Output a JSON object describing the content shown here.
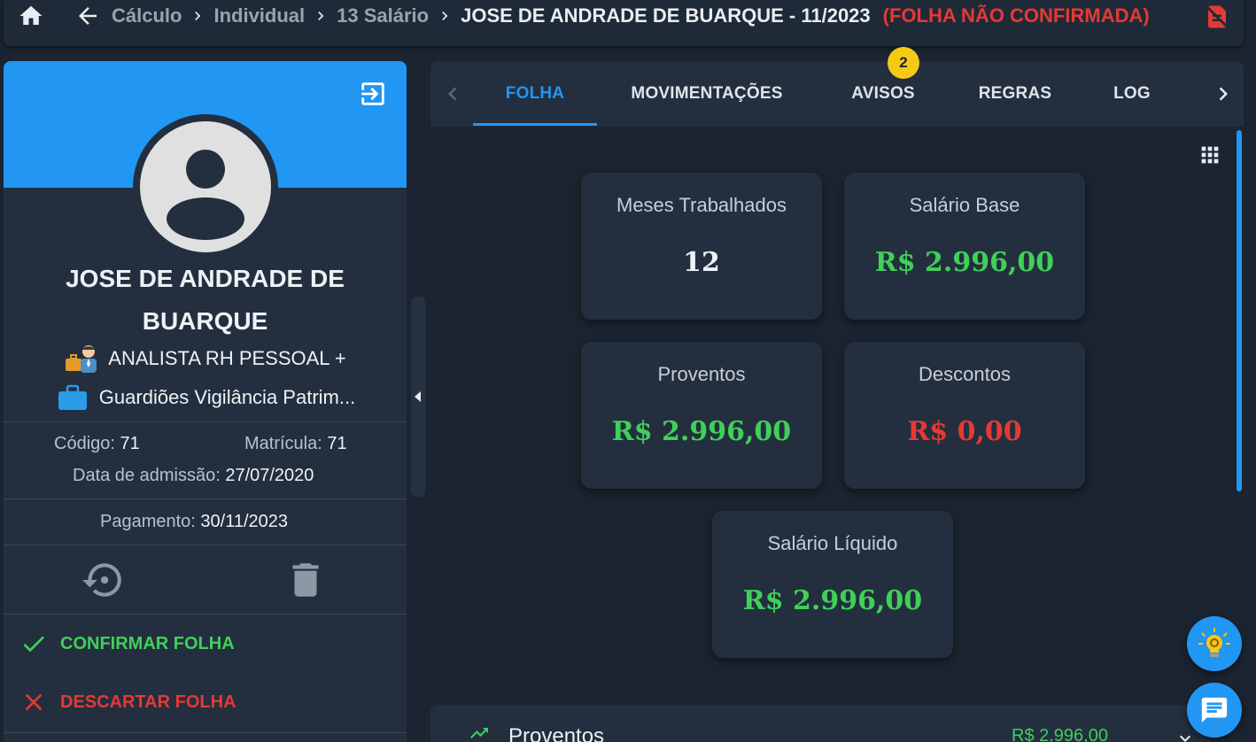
{
  "topbar": {
    "breadcrumbs": [
      "Cálculo",
      "Individual",
      "13 Salário"
    ],
    "current": "JOSE DE ANDRADE DE BUARQUE - 11/2023",
    "status": "(FOLHA NÃO CONFIRMADA)"
  },
  "profile": {
    "name_line1": "JOSE DE ANDRADE DE",
    "name_line2": "BUARQUE",
    "role": "ANALISTA RH PESSOAL +",
    "company": "Guardiões Vigilância Patrim...",
    "codigo_label": "Código:",
    "codigo": "71",
    "matricula_label": "Matrícula:",
    "matricula": "71",
    "admissao_label": "Data de admissão:",
    "admissao": "27/07/2020",
    "pagamento_label": "Pagamento:",
    "pagamento": "30/11/2023",
    "confirm_label": "CONFIRMAR FOLHA",
    "discard_label": "DESCARTAR FOLHA"
  },
  "tabs": {
    "items": [
      "FOLHA",
      "MOVIMENTAÇÕES",
      "AVISOS",
      "REGRAS",
      "LOG"
    ],
    "active": "FOLHA",
    "avisos_badge": "2"
  },
  "cards": {
    "meses": {
      "label": "Meses Trabalhados",
      "value": "12"
    },
    "salario_base": {
      "label": "Salário Base",
      "value": "R$ 2.996,00"
    },
    "proventos": {
      "label": "Proventos",
      "value": "R$ 2.996,00"
    },
    "descontos": {
      "label": "Descontos",
      "value": "R$ 0,00"
    },
    "liquido": {
      "label": "Salário Líquido",
      "value": "R$ 2.996,00"
    }
  },
  "summary": {
    "label": "Proventos",
    "value": "R$ 2.996,00"
  },
  "colors": {
    "accent": "#2196f3",
    "positive": "#3fd05a",
    "negative": "#e53935",
    "badge": "#f6c915"
  }
}
